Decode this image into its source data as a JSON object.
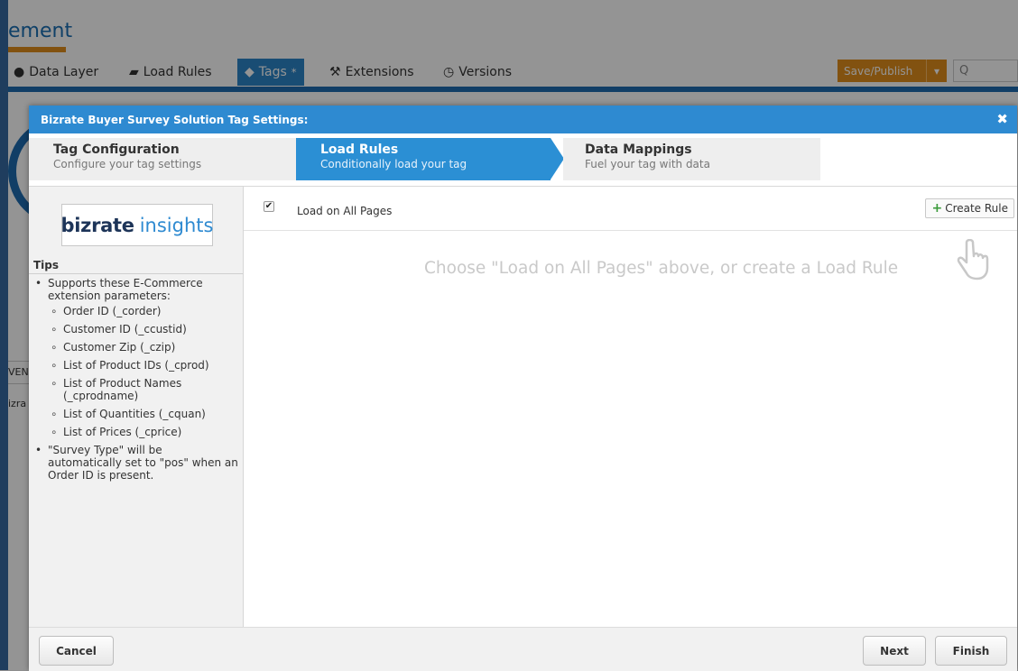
{
  "background": {
    "title": "ement",
    "nav": {
      "data_layer": "Data Layer",
      "load_rules": "Load Rules",
      "tags": "Tags",
      "tags_marker": "*",
      "extensions": "Extensions",
      "versions": "Versions"
    },
    "save_publish": "Save/Publish",
    "search_glyph": "Q",
    "side_fragment_1": "VEN",
    "side_fragment_2": "izra"
  },
  "modal": {
    "title": "Bizrate Buyer Survey Solution Tag Settings:",
    "close": "✖",
    "steps": [
      {
        "title": "Tag Configuration",
        "subtitle": "Configure your tag settings"
      },
      {
        "title": "Load Rules",
        "subtitle": "Conditionally load your tag"
      },
      {
        "title": "Data Mappings",
        "subtitle": "Fuel your tag with data"
      }
    ],
    "logo": {
      "bold": "bizrate",
      "light": "insights"
    },
    "tips": {
      "heading": "Tips",
      "intro": "Supports these E-Commerce extension parameters:",
      "params": [
        "Order ID (_corder)",
        "Customer ID (_ccustid)",
        "Customer Zip (_czip)",
        "List of Product IDs (_cprod)",
        "List of Product Names (_cprodname)",
        "List of Quantities (_cquan)",
        "List of Prices (_cprice)"
      ],
      "note": "\"Survey Type\" will be automatically set to \"pos\" when an Order ID is present."
    },
    "load_all_pages": {
      "label": "Load on All Pages",
      "checked": true,
      "check_glyph": "✔"
    },
    "create_rule": {
      "plus": "+",
      "label": "Create Rule"
    },
    "empty_message": "Choose \"Load on All Pages\" above, or create a Load Rule",
    "buttons": {
      "cancel": "Cancel",
      "next": "Next",
      "finish": "Finish"
    }
  },
  "colors": {
    "header_blue": "#2e8ad1",
    "active_step": "#2b8fd4",
    "orange": "#e08e1c",
    "plus_green": "#3b9b3b"
  }
}
